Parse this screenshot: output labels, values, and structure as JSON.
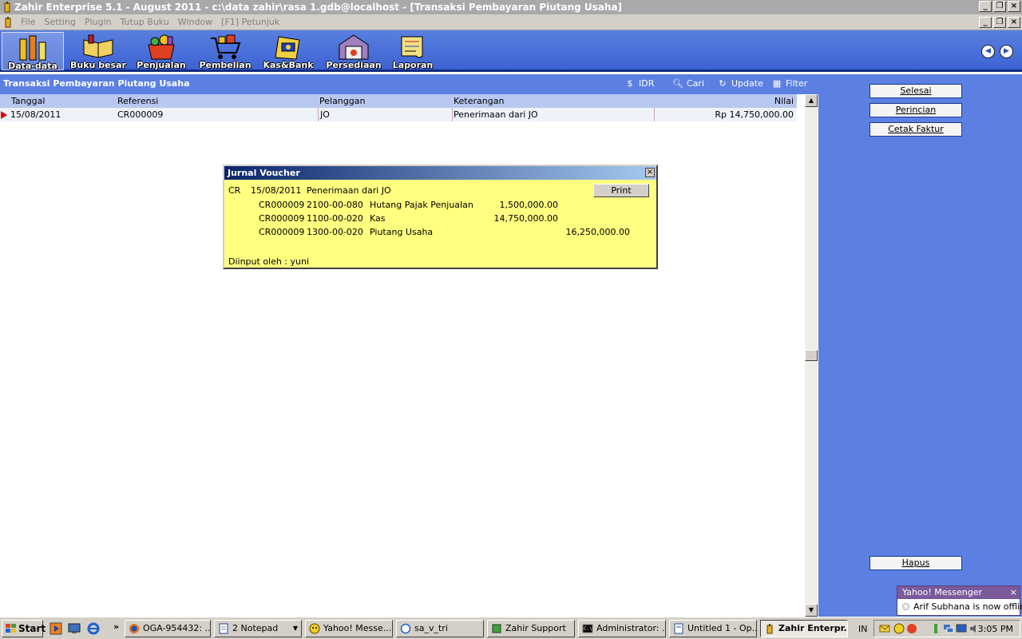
{
  "window": {
    "title": "Zahir Enterprise 5.1 - August 2011 - c:\\data zahir\\rasa 1.gdb@localhost - [Transaksi Pembayaran Piutang Usaha]"
  },
  "menu": {
    "items": [
      "File",
      "Setting",
      "Plugin",
      "Tutup Buku",
      "Window",
      "[F1] Petunjuk"
    ]
  },
  "toolbar": {
    "items": [
      {
        "label": "Data-data",
        "icon": "data-data-icon"
      },
      {
        "label": "Buku besar",
        "icon": "ledger-book-icon"
      },
      {
        "label": "Penjualan",
        "icon": "sales-basket-icon"
      },
      {
        "label": "Pembelian",
        "icon": "purchase-cart-icon"
      },
      {
        "label": "Kas&Bank",
        "icon": "cash-bank-icon"
      },
      {
        "label": "Persediaan",
        "icon": "inventory-warehouse-icon"
      },
      {
        "label": "Laporan",
        "icon": "report-scroll-icon"
      }
    ]
  },
  "subheader": {
    "title": "Transaksi Pembayaran Piutang Usaha",
    "currency": "IDR",
    "search": "Cari",
    "update": "Update",
    "filter": "Filter"
  },
  "grid": {
    "columns": [
      "Tanggal",
      "Referensi",
      "Pelanggan",
      "Keterangan",
      "Nilai"
    ],
    "rows": [
      {
        "tanggal": "15/08/2011",
        "referensi": "CR000009",
        "pelanggan": "JO",
        "keterangan": "Penerimaan dari JO",
        "nilai": "Rp 14,750,000.00"
      }
    ]
  },
  "rightpanel": {
    "selesai": "Selesai",
    "perincian": "Perincian",
    "cetak_faktur": "Cetak Faktur",
    "hapus": "Hapus"
  },
  "voucher": {
    "title": "Jurnal Voucher",
    "type": "CR",
    "date": "15/08/2011",
    "description": "Penerimaan dari JO",
    "print_label": "Print",
    "lines": [
      {
        "ref": "CR000009",
        "account": "2100-00-080",
        "name": "Hutang Pajak Penjualan",
        "debit": "1,500,000.00",
        "credit": ""
      },
      {
        "ref": "CR000009",
        "account": "1100-00-020",
        "name": "Kas",
        "debit": "14,750,000.00",
        "credit": ""
      },
      {
        "ref": "CR000009",
        "account": "1300-00-020",
        "name": "Piutang Usaha",
        "debit": "",
        "credit": "16,250,000.00"
      }
    ],
    "input_by": "Diinput oleh : yuni"
  },
  "notification": {
    "title": "Yahoo! Messenger",
    "message": "Arif Subhana is now offline"
  },
  "taskbar": {
    "start": "Start",
    "tasks": [
      {
        "label": "OGA-954432: ..."
      },
      {
        "label": "2 Notepad"
      },
      {
        "label": "Yahoo! Messe..."
      },
      {
        "label": "sa_v_tri"
      },
      {
        "label": "Zahir Support"
      },
      {
        "label": "Administrator: ..."
      },
      {
        "label": "Untitled 1 - Op..."
      },
      {
        "label": "Zahir Enterpr..."
      }
    ],
    "language": "IN",
    "clock": "3:05 PM"
  }
}
